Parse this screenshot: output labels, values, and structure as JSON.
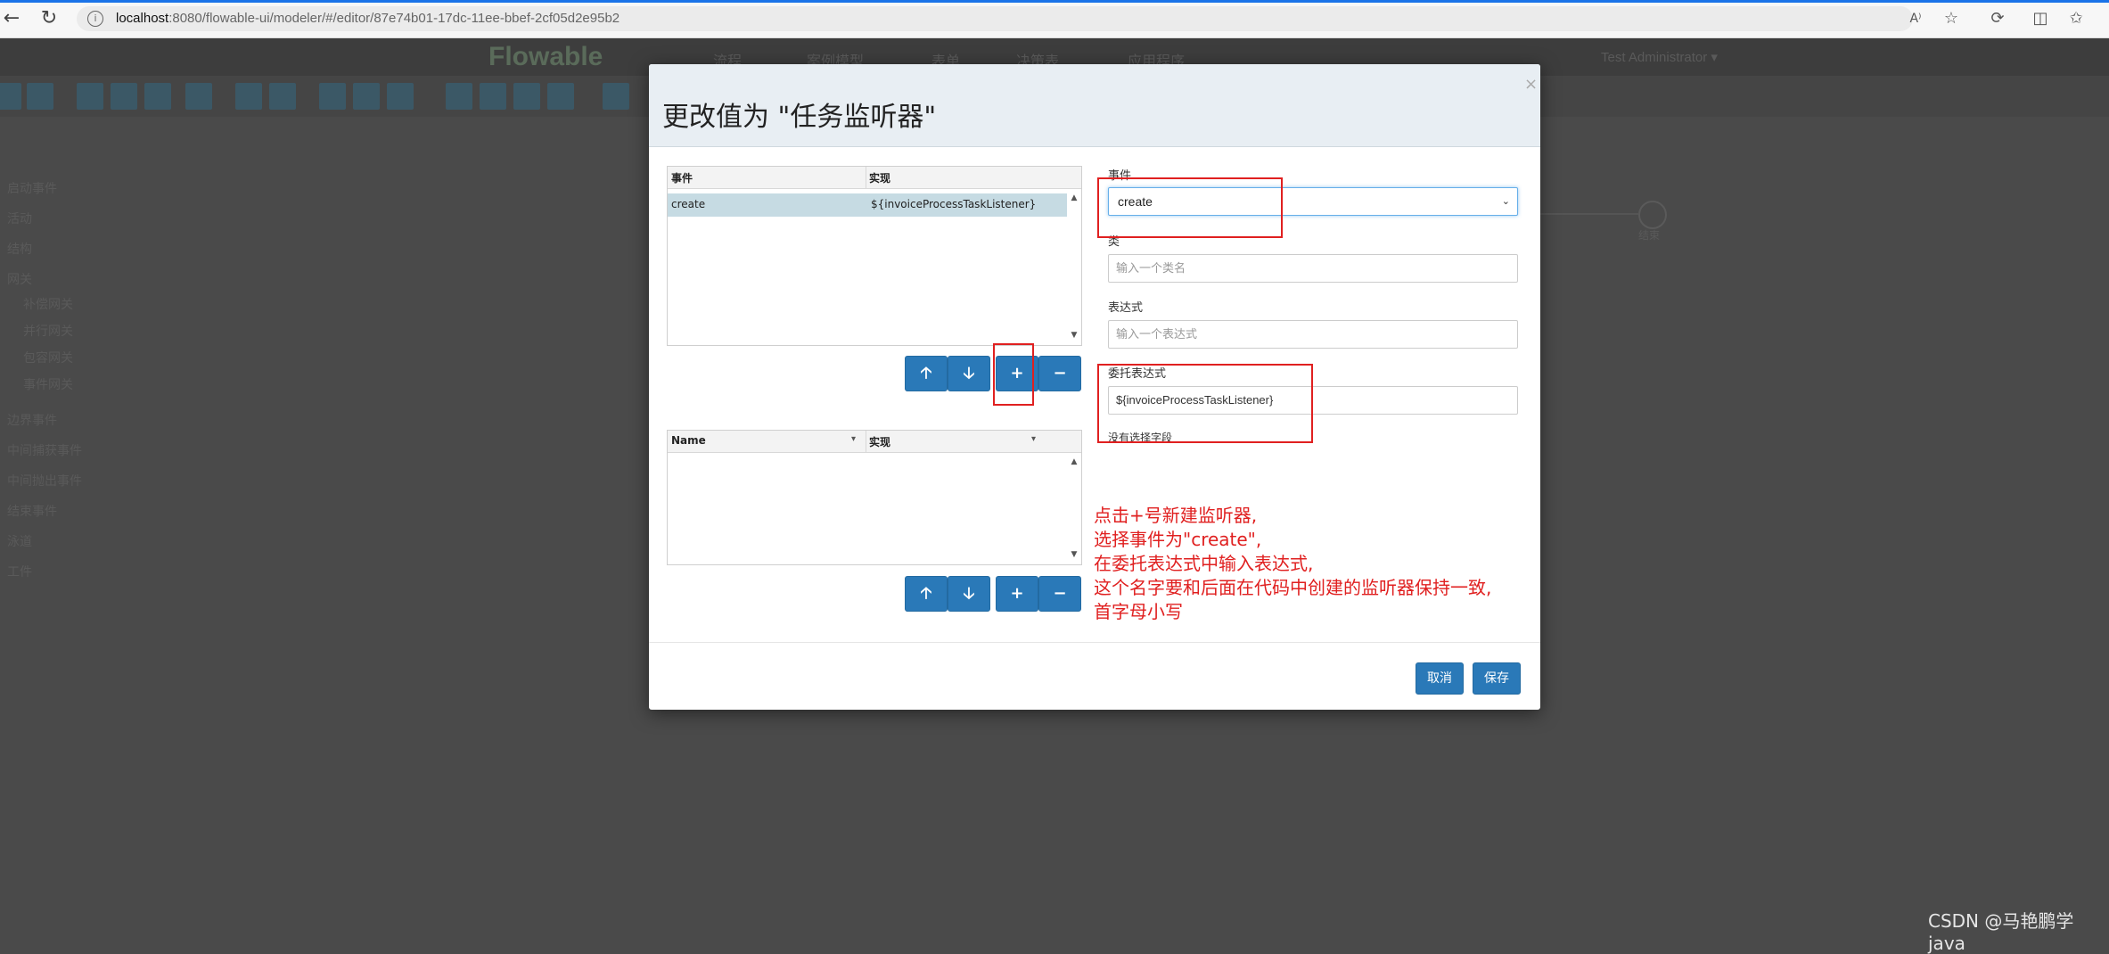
{
  "browser": {
    "url_host": "localhost",
    "url_rest": ":8080/flowable-ui/modeler/#/editor/87e74b01-17dc-11ee-bbef-2cf05d2e95b2"
  },
  "app": {
    "logo": "Flowable",
    "nav": [
      "流程",
      "案例模型",
      "表单",
      "决策表",
      "应用程序"
    ],
    "user": "Test Administrator ▾",
    "palette": [
      "启动事件",
      "活动",
      "结构",
      "网关",
      "补偿网关",
      "并行网关",
      "包容网关",
      "事件网关",
      "边界事件",
      "中间捕获事件",
      "中间抛出事件",
      "结束事件",
      "泳道",
      "工件"
    ],
    "canvas_label": "结束"
  },
  "modal": {
    "title": "更改值为 \"任务监听器\"",
    "close": "×",
    "listeners_grid": {
      "columns": [
        "事件",
        "实现"
      ],
      "rows": [
        {
          "event": "create",
          "impl": "${invoiceProcessTaskListener}"
        }
      ]
    },
    "fields_grid": {
      "columns": [
        "Name",
        "实现"
      ]
    },
    "buttons": {
      "up": "🡡",
      "down": "🡣",
      "add": "+",
      "remove": "−"
    },
    "form": {
      "event_label": "事件",
      "event_value": "create",
      "class_label": "类",
      "class_placeholder": "输入一个类名",
      "expression_label": "表达式",
      "expression_placeholder": "输入一个表达式",
      "delegate_label": "委托表达式",
      "delegate_value": "${invoiceProcessTaskListener}",
      "no_field": "没有选择字段"
    },
    "cancel": "取消",
    "save": "保存"
  },
  "annotation": [
    "点击+号新建监听器,",
    "选择事件为\"create\",",
    "在委托表达式中输入表达式,",
    "这个名字要和后面在代码中创建的监听器保持一致,",
    "首字母小写"
  ],
  "watermark": "CSDN @马艳鹏学java",
  "colors": {
    "primary_button": "#2a79b8",
    "annotation_red": "#e02020",
    "selected_row": "#c6dbe3"
  }
}
